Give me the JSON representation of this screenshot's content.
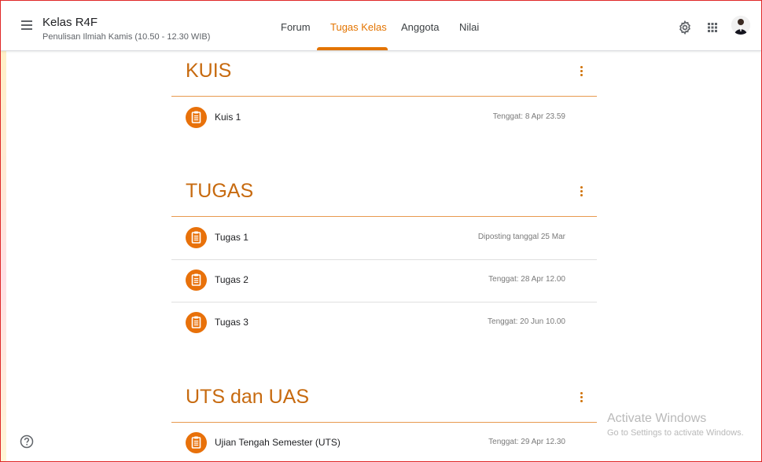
{
  "header": {
    "class_name": "Kelas R4F",
    "class_subtitle": "Penulisan Ilmiah Kamis (10.50 - 12.30 WIB)",
    "tabs": [
      {
        "label": "Forum"
      },
      {
        "label": "Tugas Kelas"
      },
      {
        "label": "Anggota"
      },
      {
        "label": "Nilai"
      }
    ],
    "active_tab": "Tugas Kelas"
  },
  "colors": {
    "accent": "#e37400",
    "section_title": "#c76a0f",
    "item_icon": "#e8710a"
  },
  "icons": {
    "menu": "hamburger-menu-icon",
    "settings": "gear-icon",
    "apps": "apps-grid-icon",
    "help": "help-icon",
    "assignment": "assignment-icon",
    "more": "more-vert-icon"
  },
  "sections": [
    {
      "title": "KUIS",
      "items": [
        {
          "title": "Kuis 1",
          "date": "Tenggat: 8 Apr 23.59"
        }
      ]
    },
    {
      "title": "TUGAS",
      "items": [
        {
          "title": "Tugas 1",
          "date": "Diposting tanggal 25 Mar"
        },
        {
          "title": "Tugas 2",
          "date": "Tenggat: 28 Apr 12.00"
        },
        {
          "title": "Tugas 3",
          "date": "Tenggat: 20 Jun 10.00"
        }
      ]
    },
    {
      "title": "UTS dan UAS",
      "items": [
        {
          "title": "Ujian Tengah Semester (UTS)",
          "date": "Tenggat: 29 Apr 12.30"
        }
      ]
    }
  ],
  "watermark": {
    "line1": "Activate Windows",
    "line2": "Go to Settings to activate Windows."
  }
}
